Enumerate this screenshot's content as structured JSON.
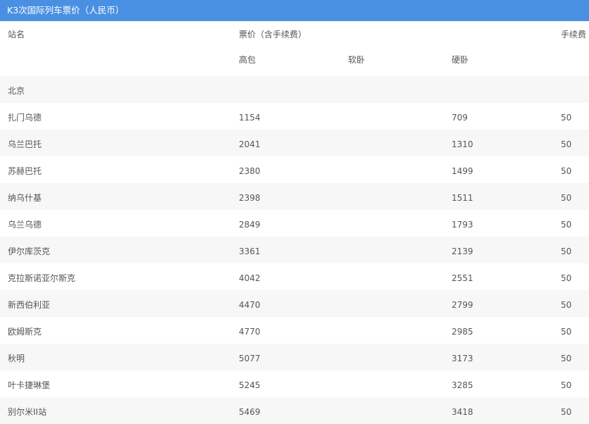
{
  "caption": "K3次国际列车票价（人民币）",
  "headers": {
    "station": "站名",
    "price_group": "票价（含手续费）",
    "fee": "手续费",
    "class_a": "高包",
    "class_b": "软卧",
    "class_c": "硬卧"
  },
  "rows": [
    {
      "station": "北京",
      "a": "",
      "b": "",
      "c": "",
      "fee": ""
    },
    {
      "station": "扎门乌德",
      "a": "1154",
      "b": "",
      "c": "709",
      "fee": "50"
    },
    {
      "station": "乌兰巴托",
      "a": "2041",
      "b": "",
      "c": "1310",
      "fee": "50"
    },
    {
      "station": "苏赫巴托",
      "a": "2380",
      "b": "",
      "c": "1499",
      "fee": "50"
    },
    {
      "station": "纳乌什基",
      "a": "2398",
      "b": "",
      "c": "1511",
      "fee": "50"
    },
    {
      "station": "乌兰乌德",
      "a": "2849",
      "b": "",
      "c": "1793",
      "fee": "50"
    },
    {
      "station": "伊尔库茨克",
      "a": "3361",
      "b": "",
      "c": "2139",
      "fee": "50"
    },
    {
      "station": "克拉斯诺亚尔斯克",
      "a": "4042",
      "b": "",
      "c": "2551",
      "fee": "50"
    },
    {
      "station": "新西伯利亚",
      "a": "4470",
      "b": "",
      "c": "2799",
      "fee": "50"
    },
    {
      "station": "欧姆斯克",
      "a": "4770",
      "b": "",
      "c": "2985",
      "fee": "50"
    },
    {
      "station": "秋明",
      "a": "5077",
      "b": "",
      "c": "3173",
      "fee": "50"
    },
    {
      "station": "叶卡捷琳堡",
      "a": "5245",
      "b": "",
      "c": "3285",
      "fee": "50"
    },
    {
      "station": "别尔米II站",
      "a": "5469",
      "b": "",
      "c": "3418",
      "fee": "50"
    }
  ]
}
